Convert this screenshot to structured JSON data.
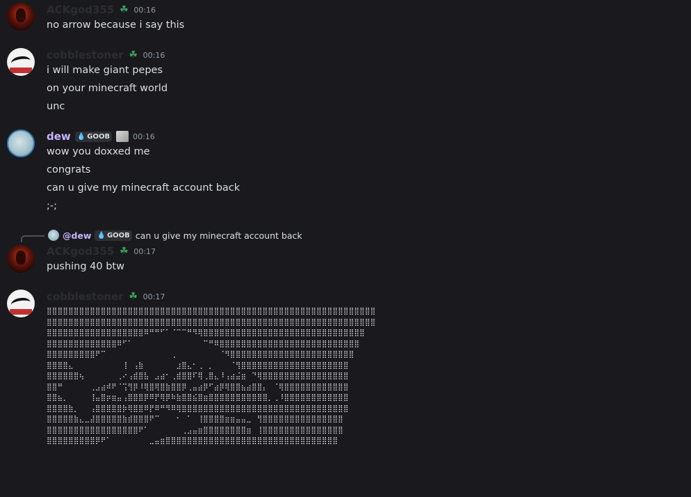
{
  "messages": [
    {
      "author": "ACKgod355",
      "role_icon": "clover-icon",
      "time": "00:16",
      "lines": [
        "no arrow because i say this"
      ]
    },
    {
      "author": "cobblestoner",
      "role_icon": "clover-icon",
      "time": "00:16",
      "lines": [
        "i will make giant pepes",
        "on your minecraft world",
        "unc"
      ]
    },
    {
      "author": "dew",
      "tag": "GOOB",
      "time": "00:16",
      "lines": [
        "wow you doxxed me",
        "congrats",
        "can u give my minecraft account back",
        ";-;"
      ]
    },
    {
      "reply": {
        "mention": "@dew",
        "tag": "GOOB",
        "text": "can u give my minecraft account back"
      },
      "author": "ACKgod355",
      "role_icon": "clover-icon",
      "time": "00:17",
      "lines": [
        "pushing 40 btw"
      ]
    },
    {
      "author": "cobblestoner",
      "role_icon": "clover-icon",
      "time": "00:17",
      "ascii_art": "⣿⣿⣿⣿⣿⣿⣿⣿⣿⣿⣿⣿⣿⣿⣿⣿⣿⣿⣿⣿⣿⣿⣿⣿⣿⣿⣿⣿⣿⣿⣿⣿⣿⣿⣿⣿⣿⣿⣿⣿⣿⣿⣿⣿⣿⣿⣿⣿⣿⣿⣿⣿⣿⣿⣿⣿⣿⣿⣿⣿⣿\n⣿⣿⣿⣿⣿⣿⣿⣿⣿⣿⣿⣿⣿⣿⣿⣿⣿⣿⣿⣿⣿⣿⣿⣿⣿⣿⣿⣿⣿⣿⣿⣿⣿⣿⣿⣿⣿⣿⣿⣿⣿⣿⣿⣿⣿⣿⣿⣿⣿⣿⣿⣿⣿⣿⣿⣿⣿⣿⣿⣿⣿\n⣿⣿⣿⣿⣿⣿⣿⣿⣿⣿⣿⣿⣿⣿⣿⣿⣿⣿⠿⠛⠛⠋⠁⠈⠉⠉⠛⠻⢿⣿⣿⣿⣿⣿⣿⣿⣿⣿⣿⣿⣿⣿⣿⣿⣿⣿⣿⣿⣿⣿⣿⣿⣿⣿⣿⣿⣿⣿⣿\n⣿⣿⣿⣿⣿⣿⣿⣿⣿⣿⣿⣿⣿⠿⠋⠁⠀⠀⠀⠀⠀⠀⠀⠀⠀⠀⠀⠀⠀⠉⠛⠿⣿⣿⣿⣿⣿⣿⣿⣿⣿⣿⣿⣿⣿⣿⣿⣿⣿⣿⣿⣿⣿⣿⣿⣿⣿⣿\n⣿⣿⣿⣿⣿⣿⣿⣿⣿⠟⠉⠀⠀⠀⠀⠀⠀⠀⠀⠀⠀⠀⠀⢀⠀⠀⠀⠀⠀⠀⠀⠀⠈⠻⣿⣿⣿⣿⣿⣿⣿⣿⣿⣿⣿⣿⣿⣿⣿⣿⣿⣿⣿⣿⣿⣿⣿\n⣿⣿⣿⣿⣄⠀⠀⠀⠀⠀⠀⠀⠀⠀⢸⠀⢠⣷⠀⠀⠀⠀⠀⠀⣰⣿⣄⠂⢀⠀⡀⠀⠀⠀⠈⢻⣿⣿⣿⣿⣿⣿⣿⣿⣿⣿⣿⣿⣿⣿⣿⣿⣿⣿⣿⣿\n⣿⣿⣿⣿⣿⣿⢦⠀⠀⠀⠀⠀⠀⢀⠔⢠⣾⣿⣧⠀⣠⣴⠂⢀⣾⣿⣿⠏⢿⢀⣿⣄⠸⢠⣴⣬⣶⠀⠙⢿⣿⣿⣿⣿⣿⣿⣿⣿⣿⣿⣿⣿⣿⣿⣿⣿\n⣿⣿⠛⠀⠀⠀⠀⠀⢀⣠⣴⠾⠟⠈⢩⢻⡿⠸⢿⣿⢿⣿⣷⣿⣿⡿⢀⣤⣴⡿⠋⣴⡿⢿⣿⣿⣦⣴⣿⣿⡄⠀⠈⢿⣿⣿⣿⣿⣿⣿⣿⣿⣿⣿⣿⣿\n⣿⣿⣦⡀⠀⠀⠀⠀⢸⣤⣿⡶⣶⣤⢠⣿⣿⣿⡿⠿⡟⢿⡿⠷⣷⣿⣿⣮⣿⣶⣿⣿⣿⣿⣿⣿⣿⣿⣿⣿⣿⡀⢀⠸⣿⣿⣿⣿⣿⣿⣿⣿⣿⣿⣿⣿\n⣿⣿⣿⣿⣷⡀⠀⠀⢠⣿⣿⣿⣿⣿⡷⢿⣿⣿⠿⡟⠿⠛⠻⠿⢿⣿⣿⣿⣿⣿⣿⣿⣿⣿⣿⣿⣿⣿⣿⣿⣿⣿⣿⣿⣿⣿⣿⣿⣿⣿⣿⣿⣿⣿⣿⣿\n⣿⣿⣿⣿⣿⣷⣄⣀⣼⣿⣿⣿⣿⣿⣷⣾⣿⣿⣿⠟⠉⠀⠀⠀⠂⠀⠁⠀⢸⣿⣿⣿⣿⣶⣶⣤⣤⣀⠀⢻⣿⣿⣿⣿⣿⣿⣿⣿⣿⣿⣿⣿⣿⣿⣿\n⣿⣿⣿⣿⣿⣿⣿⣿⣿⣿⣿⣿⣿⣿⣿⣿⣿⠟⠁⠀⠀⠀⠀⠀⠀⢀⣠⣤⣶⣿⣿⣿⣿⣿⣿⣿⣿⣶⠀⢸⣿⣿⣿⣿⣿⣿⣿⣿⣿⣿⣿⣿⣿⣿⣿\n⣿⣿⣿⣿⣿⣿⣿⣿⣿⡿⠟⠁⠀⠀⠀⠀⠀⠀⠀⣀⣤⣶⣿⣿⣿⣿⣿⣿⣿⣿⣿⣿⣿⣿⣿⣿⣿⣿⣿⣿⣿⣿⣿⣿⣿⣿⣿⣿⣿⣿⣿⣿⣿⣿"
    }
  ]
}
